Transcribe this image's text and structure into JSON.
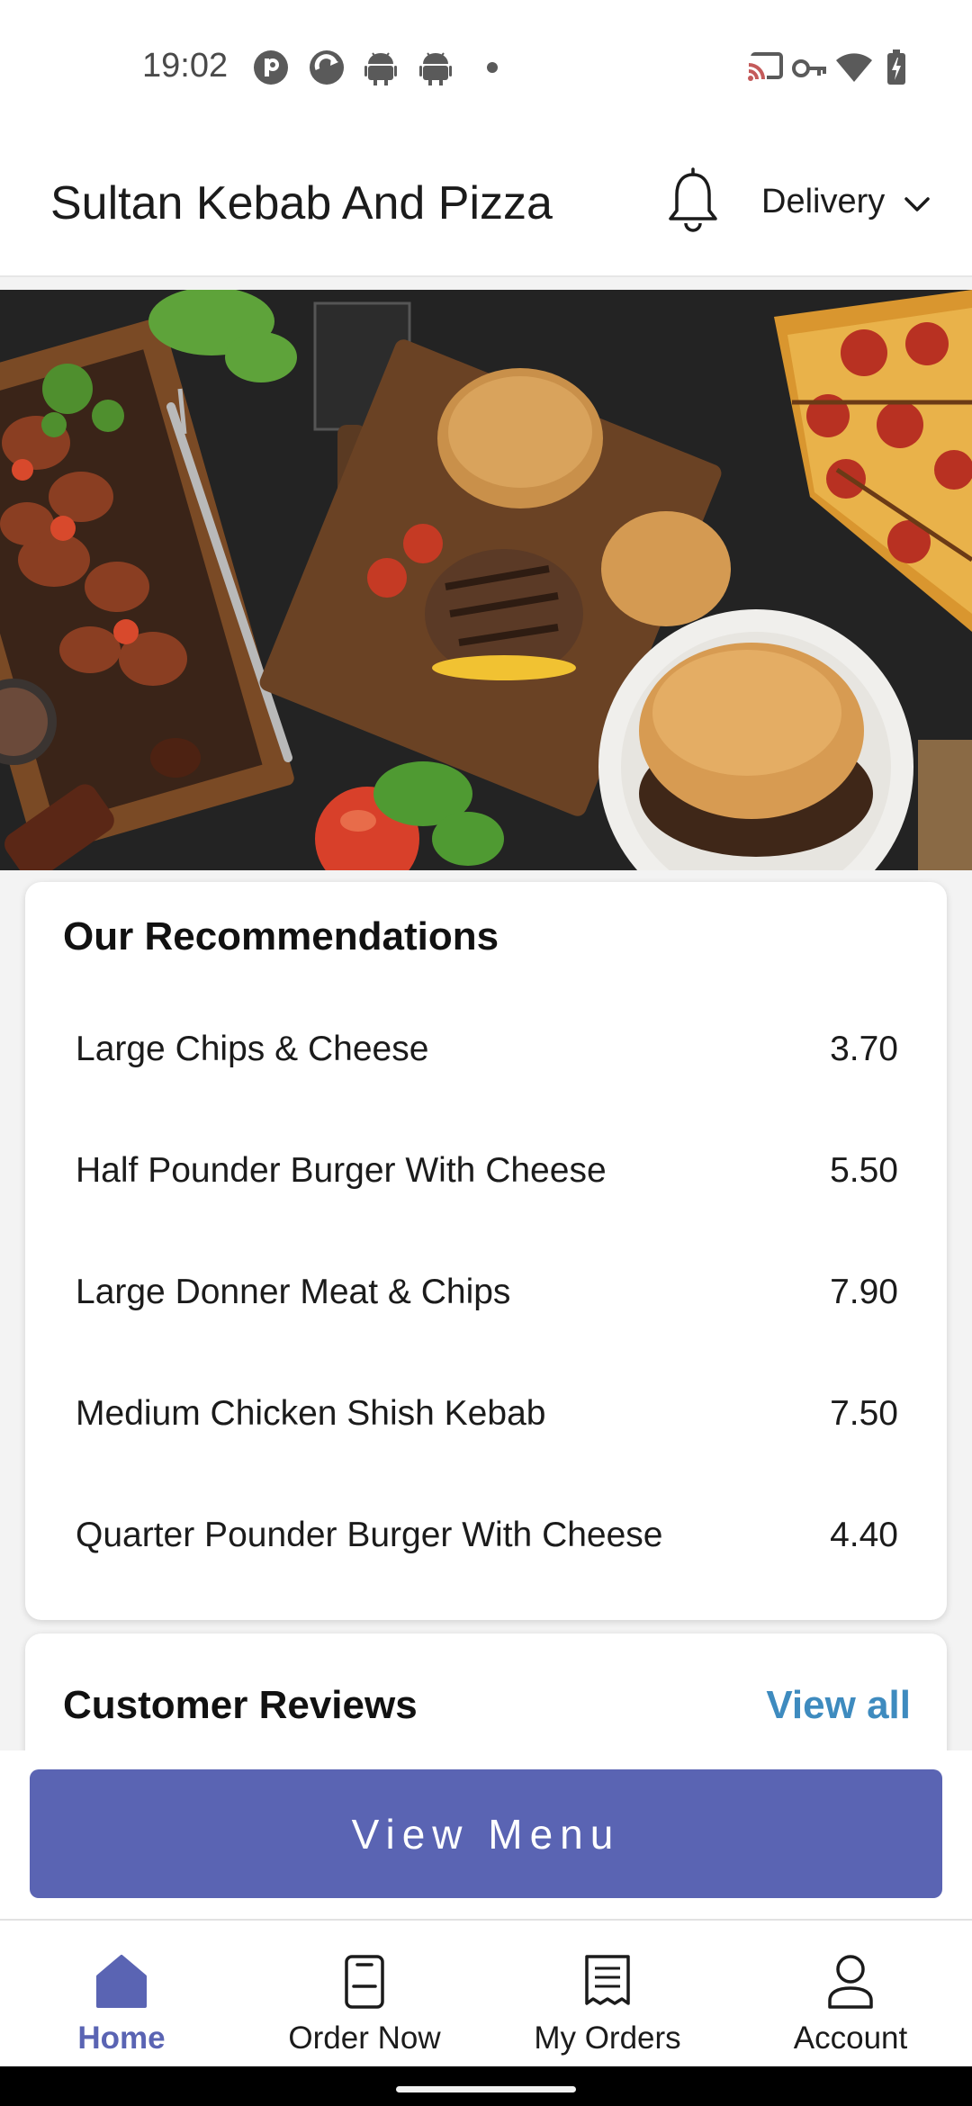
{
  "status_bar": {
    "time": "19:02"
  },
  "header": {
    "store_name": "Sultan Kebab And Pizza",
    "delivery_mode": "Delivery"
  },
  "recommendations": {
    "title": "Our Recommendations",
    "items": [
      {
        "name": "Large Chips & Cheese",
        "price": "3.70"
      },
      {
        "name": "Half Pounder Burger With Cheese",
        "price": "5.50"
      },
      {
        "name": "Large Donner Meat & Chips",
        "price": "7.90"
      },
      {
        "name": "Medium Chicken Shish Kebab",
        "price": "7.50"
      },
      {
        "name": "Quarter Pounder Burger With Cheese",
        "price": "4.40"
      }
    ]
  },
  "reviews": {
    "title": "Customer Reviews",
    "view_all_label": "View all"
  },
  "actions": {
    "view_menu_label": "View Menu"
  },
  "bottom_nav": {
    "items": [
      {
        "label": "Home",
        "icon": "home-icon",
        "active": true
      },
      {
        "label": "Order Now",
        "icon": "order-now-icon",
        "active": false
      },
      {
        "label": "My Orders",
        "icon": "receipt-icon",
        "active": false
      },
      {
        "label": "Account",
        "icon": "account-icon",
        "active": false
      }
    ]
  },
  "colors": {
    "accent": "#5a64b3",
    "link": "#3e8bbf",
    "text": "#1b1b1b"
  }
}
